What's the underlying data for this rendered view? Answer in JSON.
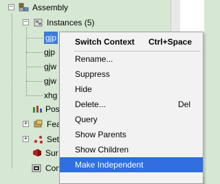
{
  "tree": {
    "assembly": "Assembly",
    "instances": "Instances (5)",
    "children": [
      "gjp",
      "gjp",
      "gjw",
      "gjw",
      "xhg"
    ],
    "pos": "Pos",
    "fea": "Fea",
    "set": "Set",
    "sur": "Sur",
    "con": "Con"
  },
  "menu": {
    "title": "Switch Context",
    "title_shortcut": "Ctrl+Space",
    "items": [
      {
        "label": "Rename...",
        "shortcut": ""
      },
      {
        "label": "Suppress",
        "shortcut": ""
      },
      {
        "label": "Hide",
        "shortcut": ""
      },
      {
        "label": "Delete...",
        "shortcut": "Del"
      },
      {
        "label": "Query",
        "shortcut": ""
      },
      {
        "label": "Show Parents",
        "shortcut": ""
      },
      {
        "label": "Show Children",
        "shortcut": ""
      },
      {
        "label": "Make Independent",
        "shortcut": ""
      }
    ]
  },
  "colors": {
    "tree_background": "#d6e8d4",
    "selection": "#3b7bd8",
    "menu_highlight": "#2f6fe0"
  },
  "icons": {
    "assembly": "assembly-icon",
    "instances": "instances-icon",
    "instance": "part-instance-icon",
    "position": "position-constraint-icon",
    "features": "features-icon",
    "sets": "sets-icon",
    "surfaces": "surfaces-icon",
    "connectors": "connectors-icon"
  }
}
